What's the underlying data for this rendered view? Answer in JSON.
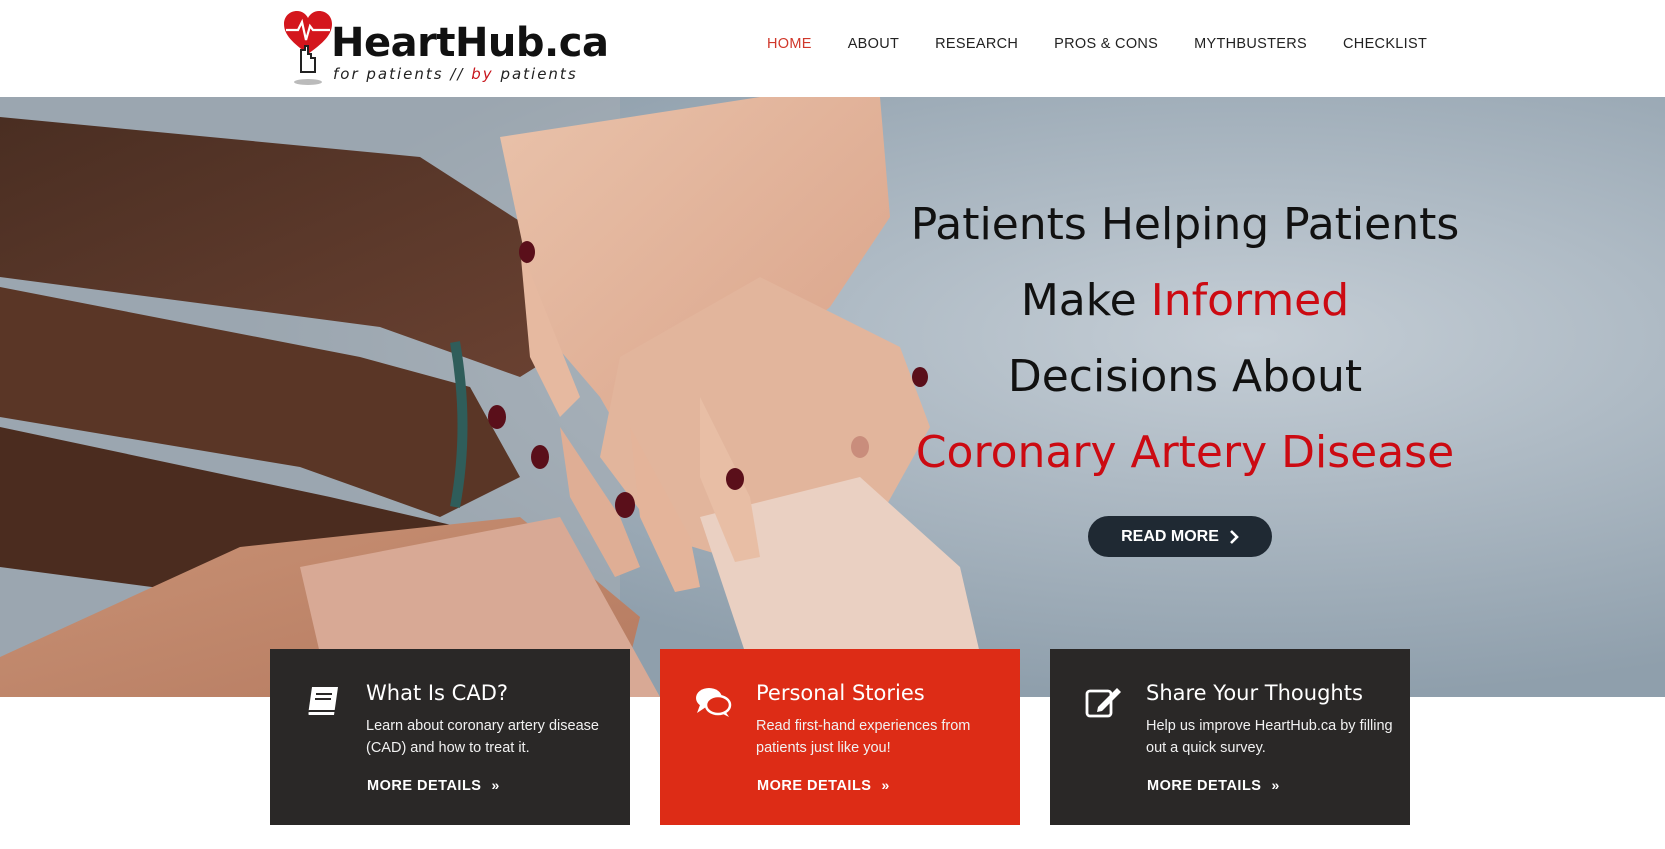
{
  "brand": {
    "name": "HeartHub.ca",
    "tag_prefix": "for patients //",
    "tag_red": "by",
    "tag_suffix": "patients",
    "accent": "#cc0a12"
  },
  "nav": {
    "items": [
      {
        "label": "HOME",
        "active": true
      },
      {
        "label": "ABOUT"
      },
      {
        "label": "RESEARCH"
      },
      {
        "label": "PROS & CONS"
      },
      {
        "label": "MYTHBUSTERS"
      },
      {
        "label": "CHECKLIST"
      }
    ],
    "active_color": "#d0372a"
  },
  "hero": {
    "line1": "Patients Helping Patients",
    "line2_plain": "Make",
    "line2_red": "Informed",
    "line3": "Decisions About",
    "line4": "Coronary Artery Disease",
    "cta_label": "READ MORE",
    "cta_icon": "chevron-right-icon"
  },
  "features": [
    {
      "icon": "book-icon",
      "title": "What Is CAD?",
      "desc": "Learn about coronary artery disease (CAD) and how to treat it.",
      "more": "MORE DETAILS",
      "bg": "#2a2827"
    },
    {
      "icon": "chat-bubbles-icon",
      "title": "Personal Stories",
      "desc": "Read first-hand experiences from patients just like you!",
      "more": "MORE DETAILS",
      "bg": "#dd2c16"
    },
    {
      "icon": "edit-icon",
      "title": "Share Your Thoughts",
      "desc": "Help us improve HeartHub.ca by filling out a quick survey.",
      "more": "MORE DETAILS",
      "bg": "#2a2827"
    }
  ]
}
